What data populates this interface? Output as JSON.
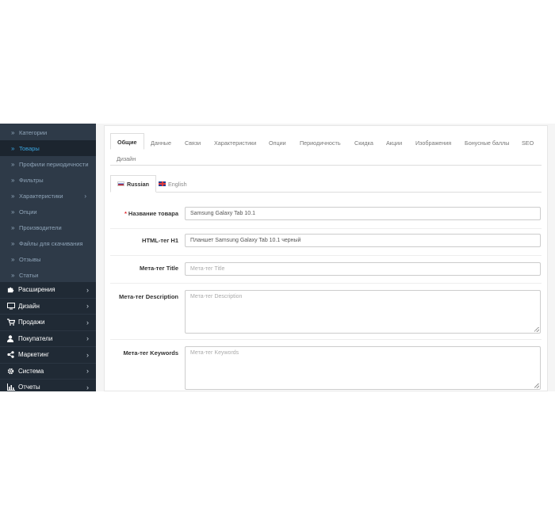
{
  "sidebar": {
    "sub_items": [
      {
        "label": "Категории",
        "active": false
      },
      {
        "label": "Товары",
        "active": true
      },
      {
        "label": "Профили периодичности",
        "active": false
      },
      {
        "label": "Фильтры",
        "active": false
      },
      {
        "label": "Характеристики",
        "active": false,
        "has_arrow": true
      },
      {
        "label": "Опции",
        "active": false
      },
      {
        "label": "Производители",
        "active": false
      },
      {
        "label": "Файлы для скачивания",
        "active": false
      },
      {
        "label": "Отзывы",
        "active": false
      },
      {
        "label": "Статьи",
        "active": false
      }
    ],
    "main_items": [
      {
        "label": "Расширения",
        "icon": "puzzle-icon"
      },
      {
        "label": "Дизайн",
        "icon": "monitor-icon"
      },
      {
        "label": "Продажи",
        "icon": "cart-icon"
      },
      {
        "label": "Покупатели",
        "icon": "user-icon"
      },
      {
        "label": "Маркетинг",
        "icon": "share-icon"
      },
      {
        "label": "Система",
        "icon": "gear-icon"
      },
      {
        "label": "Отчеты",
        "icon": "bar-chart-icon"
      }
    ],
    "chevron": "»",
    "arrow": "›"
  },
  "tabs": [
    "Общие",
    "Данные",
    "Связи",
    "Характеристики",
    "Опции",
    "Периодичность",
    "Скидка",
    "Акции",
    "Изображения",
    "Бонусные баллы",
    "SEO",
    "Дизайн"
  ],
  "active_tab": "Общие",
  "languages": [
    {
      "label": "Russian",
      "flag": "flag-ru",
      "active": true
    },
    {
      "label": "English",
      "flag": "flag-en",
      "active": false
    }
  ],
  "form": {
    "required_mark": "*",
    "fields": [
      {
        "label": "Название товара",
        "required": true,
        "value": "Samsung Galaxy Tab 10.1",
        "placeholder": ""
      },
      {
        "label": "HTML-тег H1",
        "required": false,
        "value": "Планшет Samsung Galaxy Tab 10.1 черный",
        "placeholder": ""
      },
      {
        "label": "Мета-тег Title",
        "required": false,
        "value": "",
        "placeholder": "Мета-тег Title"
      },
      {
        "label": "Мета-тег Description",
        "required": false,
        "value": "",
        "placeholder": "Мета-тег Description",
        "multiline": true
      },
      {
        "label": "Мета-тег Keywords",
        "required": false,
        "value": "",
        "placeholder": "Мета-тег Keywords",
        "multiline": true
      }
    ]
  },
  "colors": {
    "sidebar_bg": "#2e3a48",
    "sidebar_active_bg": "#1c252f",
    "sidebar_active_text": "#3aa4de",
    "required": "#e0252a"
  }
}
